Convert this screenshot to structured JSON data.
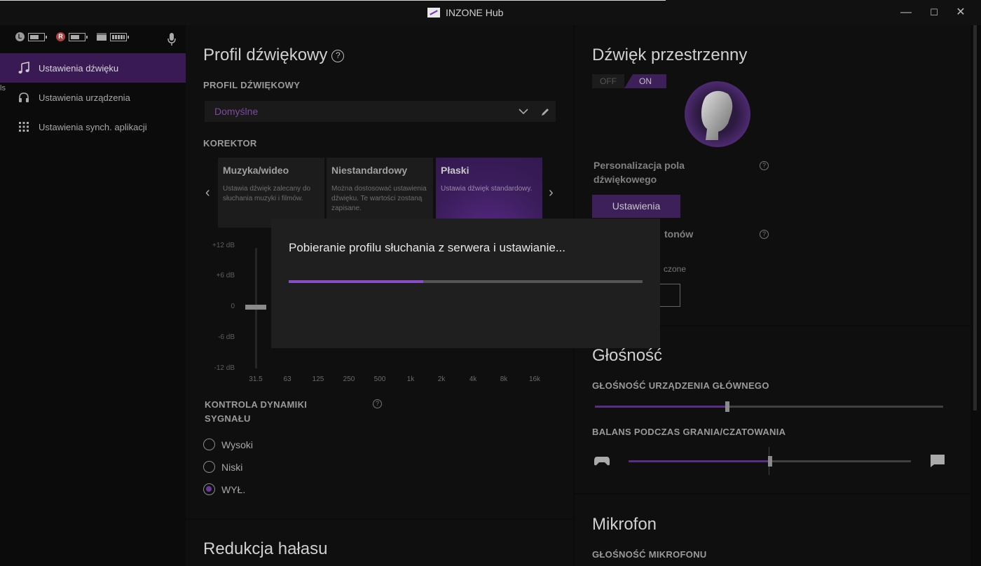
{
  "window": {
    "title": "INZONE Hub",
    "minimize": "—",
    "maximize": "☐",
    "close": "✕"
  },
  "sidebar": {
    "status": {
      "left": "L",
      "right": "R"
    },
    "cut_label": "ls",
    "items": [
      {
        "label": "Ustawienia dźwięku",
        "icon": "music-note-icon",
        "active": true
      },
      {
        "label": "Ustawienia urządzenia",
        "icon": "headphones-icon",
        "active": false
      },
      {
        "label": "Ustawienia synch. aplikacji",
        "icon": "grid-icon",
        "active": false
      }
    ]
  },
  "sound_profile": {
    "title": "Profil dźwiękowy",
    "profile_label": "PROFIL DŹWIĘKOWY",
    "selected": "Domyślne",
    "equalizer_label": "KOREKTOR",
    "presets": [
      {
        "title": "Muzyka/wideo",
        "desc": "Ustawia dźwięk zalecany do słuchania muzyki i filmów."
      },
      {
        "title": "Niestandardowy",
        "desc": "Można dostosować ustawienia dźwięku. Te wartości zostaną zapisane."
      },
      {
        "title": "Płaski",
        "desc": "Ustawia dźwięk standardowy."
      }
    ],
    "selected_preset": "Płaski",
    "db_labels": [
      "+12 dB",
      "+6 dB",
      "0",
      "-6 dB",
      "-12 dB"
    ],
    "frequencies": [
      "31.5",
      "63",
      "125",
      "250",
      "500",
      "1k",
      "2k",
      "4k",
      "8k",
      "16k"
    ],
    "dynamics_label": "KONTROLA DYNAMIKI SYGNAŁU",
    "dynamics_options": [
      "Wysoki",
      "Niski",
      "WYŁ."
    ],
    "dynamics_selected": "WYŁ."
  },
  "noise_reduction": {
    "title": "Redukcja hałasu"
  },
  "spatial": {
    "title": "Dźwięk przestrzenny",
    "toggle_off": "OFF",
    "toggle_on": "ON",
    "toggle_state": "ON",
    "personalization_label": "Personalizacja pola dźwiękowego",
    "settings_button": "Ustawienia",
    "partial_label_1": "tonów",
    "partial_label_2": "czone"
  },
  "volume": {
    "title": "Głośność",
    "main_label": "GŁOŚNOŚĆ URZĄDZENIA GŁÓWNEGO",
    "main_value": 0.38,
    "balance_label": "BALANS PODCZAS GRANIA/CZATOWANIA",
    "balance_value": 0.5
  },
  "microphone": {
    "title": "Mikrofon",
    "volume_label": "GŁOŚNOŚĆ MIKROFONU"
  },
  "modal": {
    "message": "Pobieranie profilu słuchania z serwera i ustawianie...",
    "progress": 0.38
  },
  "colors": {
    "accent": "#5a2d85",
    "accent_light": "#8a4cc7",
    "panel": "#0f0f0f"
  }
}
